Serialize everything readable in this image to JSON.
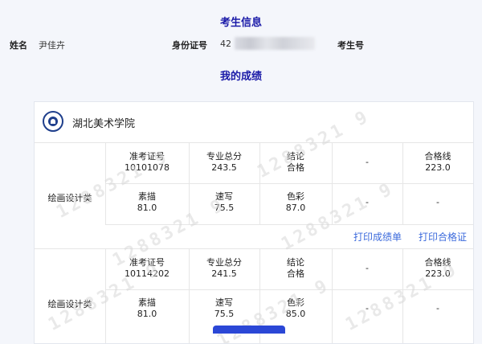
{
  "header": {
    "title": "考生信息"
  },
  "info": {
    "name_label": "姓名",
    "name_value": "尹佳卉",
    "id_label": "身份证号",
    "id_value_visible": "42",
    "exam_no_label": "考生号"
  },
  "results": {
    "title": "我的成绩"
  },
  "school": {
    "name": "湖北美术学院",
    "logo_icon": "school-logo-icon"
  },
  "records": [
    {
      "category": "绘画设计类",
      "ticket_label": "准考证号",
      "ticket_value": "10101078",
      "total_label": "专业总分",
      "total_value": "243.5",
      "result_label": "结论",
      "result_value": "合格",
      "dash1": "-",
      "pass_label": "合格线",
      "pass_value": "223.0",
      "sketch_label": "素描",
      "sketch_value": "81.0",
      "quick_label": "速写",
      "quick_value": "75.5",
      "color_label": "色彩",
      "color_value": "87.0",
      "dash2": "-",
      "dash3": "-"
    },
    {
      "category": "绘画设计类",
      "ticket_label": "准考证号",
      "ticket_value": "10114202",
      "total_label": "专业总分",
      "total_value": "241.5",
      "result_label": "结论",
      "result_value": "合格",
      "dash1": "-",
      "pass_label": "合格线",
      "pass_value": "223.0",
      "sketch_label": "素描",
      "sketch_value": "81.0",
      "quick_label": "速写",
      "quick_value": "75.5",
      "color_label": "色彩",
      "color_value": "85.0",
      "dash2": "-",
      "dash3": "-"
    }
  ],
  "actions": {
    "print_scores": "打印成绩单",
    "print_cert": "打印合格证"
  },
  "watermark": {
    "text": "1288321 9"
  },
  "colors": {
    "title_blue": "#1a1aa8",
    "link_blue": "#3d6bdc",
    "button_blue": "#2b47d6"
  }
}
